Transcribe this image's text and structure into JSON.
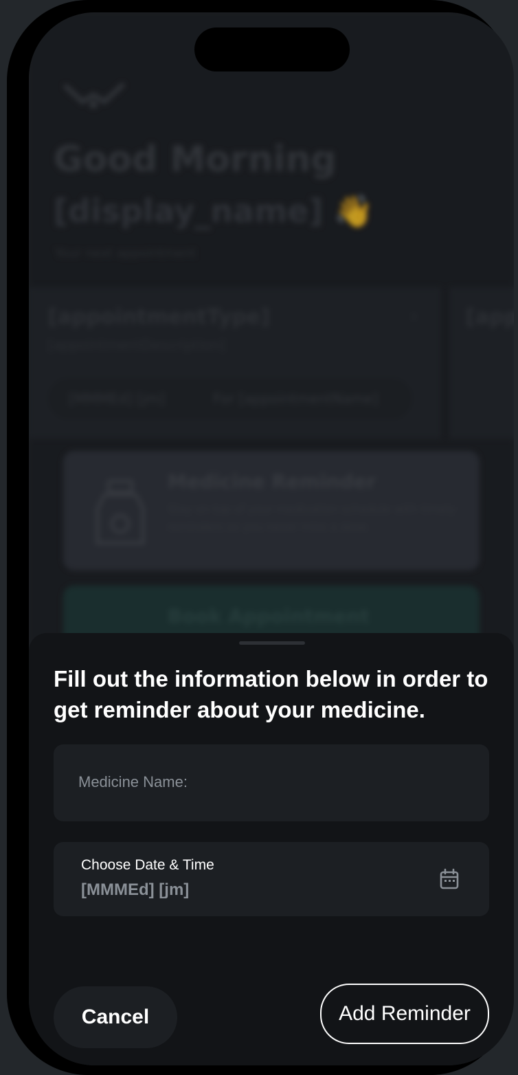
{
  "home": {
    "greeting": "Good Morning",
    "display_name": "[display_name]",
    "wave_emoji": "👋",
    "next_appointment_label": "Your next appointment",
    "appointment": {
      "type": "[appointmentType]",
      "description": "[appointmentDescription]",
      "date": "[MMMEd] [jm]",
      "for_label": "For",
      "for_value": "[appointmentName]"
    },
    "appointment_peek_type": "[appo",
    "medicine_card": {
      "title": "Medicine Reminder",
      "description": "Stay on top of your medication schedule with timely reminders so you never miss a dose."
    },
    "book_card": {
      "title": "Book Appointment"
    }
  },
  "sheet": {
    "title": "Fill out the information below in order to get reminder about your medicine.",
    "medicine_placeholder": "Medicine Name:",
    "date_label": "Choose Date & Time",
    "date_value": "[MMMEd] [jm]",
    "cancel_label": "Cancel",
    "add_label": "Add Reminder"
  },
  "icons": {
    "calendar": "calendar-icon",
    "logo": "app-logo",
    "medicine": "medicine-bottle-icon",
    "chevron": "chevron-right-icon"
  },
  "colors": {
    "background": "#1d2024",
    "sheet": "#121417",
    "field": "#1c1f23",
    "muted_text": "#8b9198",
    "book_card": "#1f3a38"
  }
}
